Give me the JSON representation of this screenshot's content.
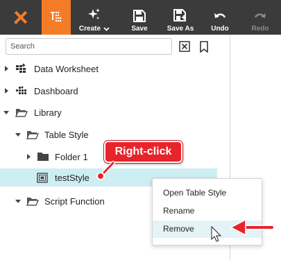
{
  "toolbar": {
    "create": "Create",
    "save": "Save",
    "save_as": "Save As",
    "undo": "Undo",
    "redo": "Redo"
  },
  "search": {
    "placeholder": "Search"
  },
  "tree": {
    "data_worksheet": "Data Worksheet",
    "dashboard": "Dashboard",
    "library": "Library",
    "table_style": "Table Style",
    "folder_1": "Folder 1",
    "test_style": "testStyle",
    "script_function": "Script Function"
  },
  "context_menu": {
    "open_table_style": "Open Table Style",
    "rename": "Rename",
    "remove": "Remove"
  },
  "annotation": {
    "callout": "Right-click"
  },
  "colors": {
    "toolbar_bg": "#3b3b3b",
    "accent_orange": "#f57c27",
    "selected_row": "#cdeef2",
    "annotation_red": "#e8242b"
  }
}
